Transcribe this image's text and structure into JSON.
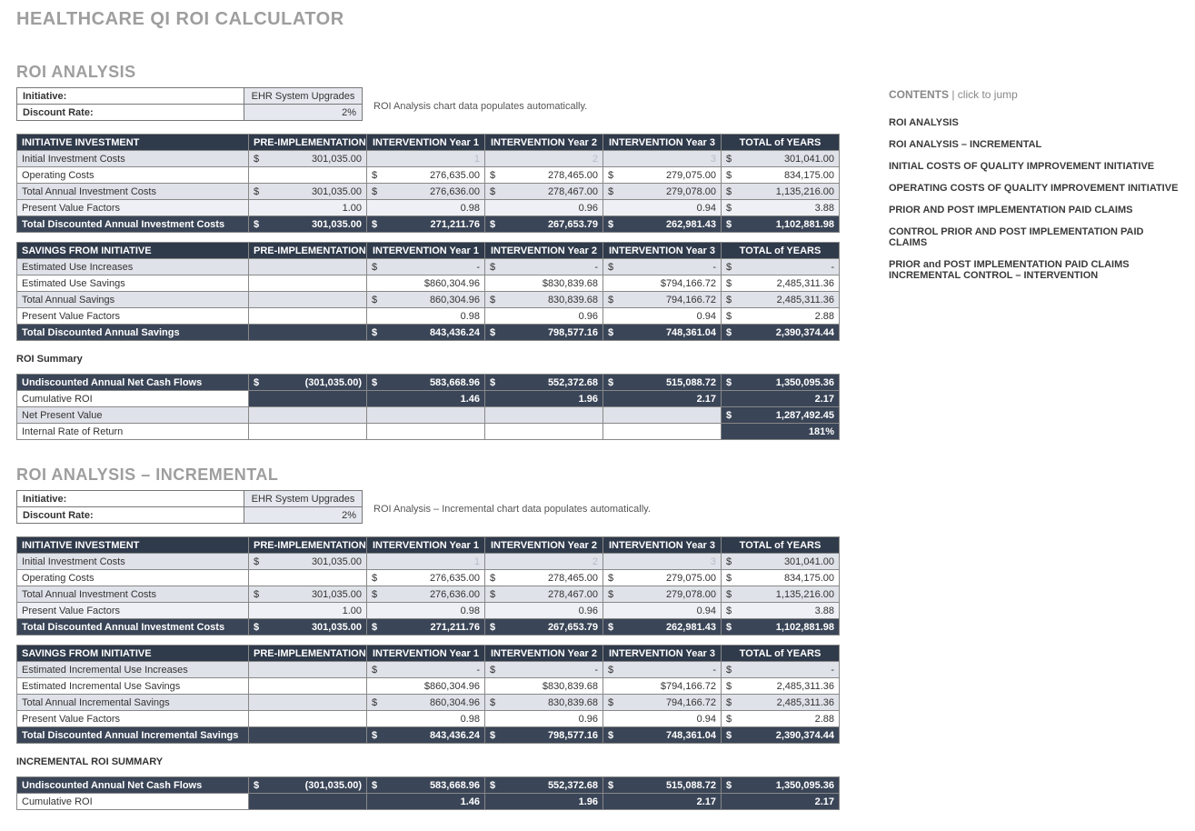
{
  "page_title": "HEALTHCARE QI ROI CALCULATOR",
  "sections": {
    "roi_analysis": {
      "title": "ROI ANALYSIS",
      "initiative_label": "Initiative:",
      "initiative_value": "EHR System Upgrades",
      "discount_label": "Discount Rate:",
      "discount_value": "2%",
      "note": "ROI Analysis chart data populates automatically.",
      "investment_hdr": "INITIATIVE INVESTMENT",
      "savings_hdr": "SAVINGS FROM INITIATIVE",
      "summary_hdr": "ROI Summary",
      "cols": {
        "pre": "PRE-IMPLEMENTATION",
        "y1": "INTERVENTION Year 1",
        "y2": "INTERVENTION Year 2",
        "y3": "INTERVENTION Year 3",
        "tot": "TOTAL of YEARS"
      },
      "investment_rows": [
        {
          "label": "Initial Investment Costs",
          "pre": "301,035.00",
          "y1": "1",
          "y2": "2",
          "y3": "3",
          "tot": "301,041.00",
          "faded": true,
          "shade": true,
          "sym_pre": "$",
          "sym_tot": "$"
        },
        {
          "label": "Operating Costs",
          "pre": "",
          "y1": "276,635.00",
          "y2": "278,465.00",
          "y3": "279,075.00",
          "tot": "834,175.00",
          "sym_y1": "$",
          "sym_y2": "$",
          "sym_y3": "$",
          "sym_tot": "$"
        },
        {
          "label": "Total Annual Investment Costs",
          "pre": "301,035.00",
          "y1": "276,636.00",
          "y2": "278,467.00",
          "y3": "279,078.00",
          "tot": "1,135,216.00",
          "shade": true,
          "sym_pre": "$",
          "sym_y1": "$",
          "sym_y2": "$",
          "sym_y3": "$",
          "sym_tot": "$"
        },
        {
          "label": "Present Value Factors",
          "pre": "1.00",
          "y1": "0.98",
          "y2": "0.96",
          "y3": "0.94",
          "tot": "3.88",
          "sym_tot": "$",
          "shade_light": true
        },
        {
          "label": "Total Discounted Annual Investment Costs",
          "pre": "301,035.00",
          "y1": "271,211.76",
          "y2": "267,653.79",
          "y3": "262,981.43",
          "tot": "1,102,881.98",
          "bold": true,
          "sym_pre": "$",
          "sym_y1": "$",
          "sym_y2": "$",
          "sym_y3": "$",
          "sym_tot": "$"
        }
      ],
      "savings_rows": [
        {
          "label": "Estimated Use Increases",
          "pre": "",
          "y1": "-",
          "y2": "-",
          "y3": "-",
          "tot": "-",
          "shade": true,
          "sym_y1": "$",
          "sym_y2": "$",
          "sym_y3": "$",
          "sym_tot": "$"
        },
        {
          "label": "Estimated Use Savings",
          "pre": "",
          "y1": "$860,304.96",
          "y2": "$830,839.68",
          "y3": "$794,166.72",
          "tot": "2,485,311.36",
          "sym_tot": "$"
        },
        {
          "label": "Total Annual Savings",
          "pre": "",
          "y1": "860,304.96",
          "y2": "830,839.68",
          "y3": "794,166.72",
          "tot": "2,485,311.36",
          "shade": true,
          "sym_y1": "$",
          "sym_y2": "$",
          "sym_y3": "$",
          "sym_tot": "$"
        },
        {
          "label": "Present Value Factors",
          "pre": "",
          "y1": "0.98",
          "y2": "0.96",
          "y3": "0.94",
          "tot": "2.88",
          "sym_tot": "$"
        },
        {
          "label": "Total Discounted Annual Savings",
          "pre": "",
          "y1": "843,436.24",
          "y2": "798,577.16",
          "y3": "748,361.04",
          "tot": "2,390,374.44",
          "bold": true,
          "sym_y1": "$",
          "sym_y2": "$",
          "sym_y3": "$",
          "sym_tot": "$"
        }
      ],
      "summary_rows": [
        {
          "label": "Undiscounted Annual Net Cash Flows",
          "pre": "(301,035.00)",
          "y1": "583,668.96",
          "y2": "552,372.68",
          "y3": "515,088.72",
          "tot": "1,350,095.36",
          "bold": true,
          "sym_pre": "$",
          "sym_y1": "$",
          "sym_y2": "$",
          "sym_y3": "$",
          "sym_tot": "$"
        },
        {
          "label": "Cumulative ROI",
          "pre": "",
          "y1": "1.46",
          "y2": "1.96",
          "y3": "2.17",
          "tot": "2.17",
          "bold": true,
          "white_lbl": true
        },
        {
          "label": "Net Present Value",
          "pre": "",
          "y1": "",
          "y2": "",
          "y3": "",
          "tot": "1,287,492.45",
          "sym_tot": "$",
          "bold_tot": true,
          "shade": true
        },
        {
          "label": "Internal Rate of Return",
          "pre": "",
          "y1": "",
          "y2": "",
          "y3": "",
          "tot": "181%",
          "bold_tot": true
        }
      ]
    },
    "roi_analysis_incremental": {
      "title": "ROI ANALYSIS – INCREMENTAL",
      "initiative_label": "Initiative:",
      "initiative_value": "EHR System Upgrades",
      "discount_label": "Discount Rate:",
      "discount_value": "2%",
      "note": "ROI Analysis – Incremental chart data populates automatically.",
      "investment_hdr": "INITIATIVE INVESTMENT",
      "savings_hdr": "SAVINGS FROM INITIATIVE",
      "summary_hdr": "INCREMENTAL ROI SUMMARY",
      "cols": {
        "pre": "PRE-IMPLEMENTATION",
        "y1": "INTERVENTION Year 1",
        "y2": "INTERVENTION Year 2",
        "y3": "INTERVENTION Year 3",
        "tot": "TOTAL of YEARS"
      },
      "investment_rows": [
        {
          "label": "Initial Investment Costs",
          "pre": "301,035.00",
          "y1": "1",
          "y2": "2",
          "y3": "3",
          "tot": "301,041.00",
          "faded": true,
          "shade": true,
          "sym_pre": "$",
          "sym_tot": "$"
        },
        {
          "label": "Operating Costs",
          "pre": "",
          "y1": "276,635.00",
          "y2": "278,465.00",
          "y3": "279,075.00",
          "tot": "834,175.00",
          "sym_y1": "$",
          "sym_y2": "$",
          "sym_y3": "$",
          "sym_tot": "$"
        },
        {
          "label": "Total Annual Investment Costs",
          "pre": "301,035.00",
          "y1": "276,636.00",
          "y2": "278,467.00",
          "y3": "279,078.00",
          "tot": "1,135,216.00",
          "shade": true,
          "sym_pre": "$",
          "sym_y1": "$",
          "sym_y2": "$",
          "sym_y3": "$",
          "sym_tot": "$"
        },
        {
          "label": "Present Value Factors",
          "pre": "1.00",
          "y1": "0.98",
          "y2": "0.96",
          "y3": "0.94",
          "tot": "3.88",
          "sym_tot": "$",
          "shade_light": true
        },
        {
          "label": "Total Discounted Annual Investment Costs",
          "pre": "301,035.00",
          "y1": "271,211.76",
          "y2": "267,653.79",
          "y3": "262,981.43",
          "tot": "1,102,881.98",
          "bold": true,
          "sym_pre": "$",
          "sym_y1": "$",
          "sym_y2": "$",
          "sym_y3": "$",
          "sym_tot": "$"
        }
      ],
      "savings_rows": [
        {
          "label": "Estimated Incremental Use Increases",
          "pre": "",
          "y1": "-",
          "y2": "-",
          "y3": "-",
          "tot": "-",
          "shade": true,
          "sym_y1": "$",
          "sym_y2": "$",
          "sym_y3": "$",
          "sym_tot": "$"
        },
        {
          "label": "Estimated Incremental Use Savings",
          "pre": "",
          "y1": "$860,304.96",
          "y2": "$830,839.68",
          "y3": "$794,166.72",
          "tot": "2,485,311.36",
          "sym_tot": "$"
        },
        {
          "label": "Total Annual Incremental Savings",
          "pre": "",
          "y1": "860,304.96",
          "y2": "830,839.68",
          "y3": "794,166.72",
          "tot": "2,485,311.36",
          "shade": true,
          "sym_y1": "$",
          "sym_y2": "$",
          "sym_y3": "$",
          "sym_tot": "$"
        },
        {
          "label": "Present Value Factors",
          "pre": "",
          "y1": "0.98",
          "y2": "0.96",
          "y3": "0.94",
          "tot": "2.88",
          "sym_tot": "$"
        },
        {
          "label": "Total Discounted Annual Incremental Savings",
          "pre": "",
          "y1": "843,436.24",
          "y2": "798,577.16",
          "y3": "748,361.04",
          "tot": "2,390,374.44",
          "bold": true,
          "sym_y1": "$",
          "sym_y2": "$",
          "sym_y3": "$",
          "sym_tot": "$"
        }
      ],
      "summary_rows": [
        {
          "label": "Undiscounted Annual Net Cash Flows",
          "pre": "(301,035.00)",
          "y1": "583,668.96",
          "y2": "552,372.68",
          "y3": "515,088.72",
          "tot": "1,350,095.36",
          "bold": true,
          "sym_pre": "$",
          "sym_y1": "$",
          "sym_y2": "$",
          "sym_y3": "$",
          "sym_tot": "$"
        },
        {
          "label": "Cumulative ROI",
          "pre": "",
          "y1": "1.46",
          "y2": "1.96",
          "y3": "2.17",
          "tot": "2.17",
          "bold": true,
          "white_lbl": true
        }
      ]
    }
  },
  "toc": {
    "header_bold": "CONTENTS",
    "header_rest": " |  click to jump",
    "items": [
      "ROI ANALYSIS",
      "ROI ANALYSIS – INCREMENTAL",
      "INITIAL COSTS OF QUALITY IMPROVEMENT INITIATIVE",
      "OPERATING COSTS OF QUALITY IMPROVEMENT INITIATIVE",
      "PRIOR AND POST IMPLEMENTATION PAID CLAIMS",
      "CONTROL PRIOR AND POST IMPLEMENTATION PAID CLAIMS",
      "PRIOR and POST IMPLEMENTATION PAID CLAIMS INCREMENTAL CONTROL – INTERVENTION"
    ]
  }
}
